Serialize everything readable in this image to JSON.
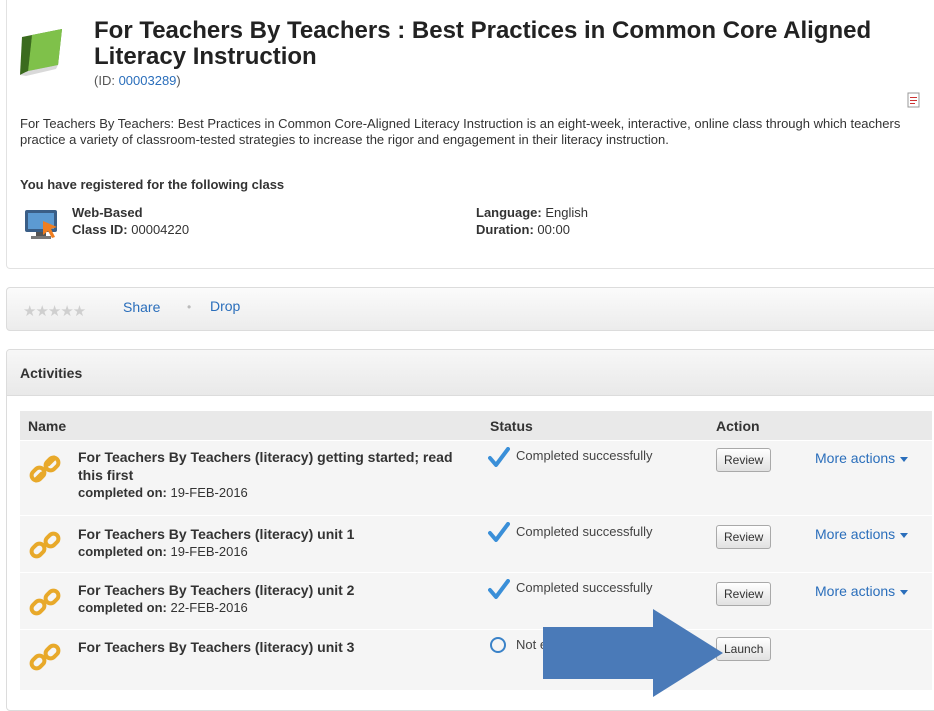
{
  "course": {
    "title": "For Teachers By Teachers : Best Practices in Common Core Aligned Literacy Instruction",
    "id_prefix": "(ID: ",
    "id_value": "00003289",
    "id_suffix": ")",
    "description": "For Teachers By Teachers: Best Practices in Common Core-Aligned Literacy Instruction is an eight-week, interactive, online class through which teachers practice a variety of classroom-tested strategies to increase the rigor and engagement in their literacy instruction."
  },
  "registration": {
    "label": "You have registered for the following class",
    "delivery": "Web-Based",
    "class_id_label": "Class ID:",
    "class_id_value": "00004220",
    "language_label": "Language:",
    "language_value": "English",
    "duration_label": "Duration:",
    "duration_value": "00:00"
  },
  "actions_bar": {
    "stars": "★★★★★",
    "share_label": "Share",
    "separator": "•",
    "drop_label": "Drop"
  },
  "activities": {
    "title": "Activities",
    "columns": [
      "Name",
      "Status",
      "Action"
    ],
    "completed_label": "completed on:",
    "rows": [
      {
        "name": "For Teachers By Teachers (literacy) getting started; read this first",
        "completed_on": "19-FEB-2016",
        "status": "Completed successfully",
        "button": "Review",
        "more": "More actions"
      },
      {
        "name": "For Teachers By Teachers (literacy) unit 1",
        "completed_on": "19-FEB-2016",
        "status": "Completed successfully",
        "button": "Review",
        "more": "More actions"
      },
      {
        "name": "For Teachers By Teachers (literacy) unit 2",
        "completed_on": "22-FEB-2016",
        "status": "Completed successfully",
        "button": "Review",
        "more": "More actions"
      },
      {
        "name": "For Teachers By Teachers (literacy) unit 3",
        "status": "Not ev",
        "button": "Launch"
      }
    ]
  },
  "colors": {
    "link": "#2a6ebb",
    "check": "#3a8fd8",
    "arrow": "#4a7ab8"
  },
  "icons": [
    "book-icon",
    "pdf-icon",
    "monitor-icon",
    "star-rating",
    "chain-link-icon",
    "checkmark-icon",
    "empty-circle-icon",
    "caret-down-icon",
    "annotation-arrow"
  ]
}
